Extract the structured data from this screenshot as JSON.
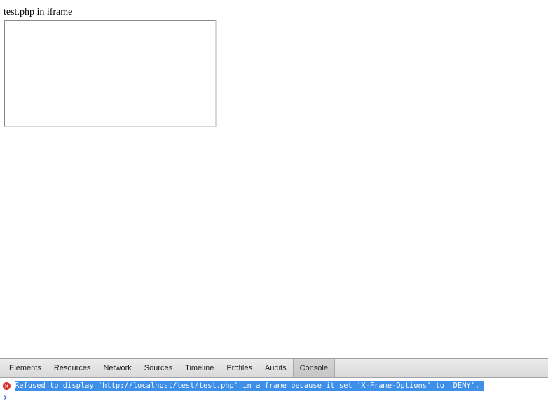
{
  "page": {
    "heading": "test.php in iframe"
  },
  "devtools": {
    "tabs": [
      {
        "label": "Elements",
        "selected": false
      },
      {
        "label": "Resources",
        "selected": false
      },
      {
        "label": "Network",
        "selected": false
      },
      {
        "label": "Sources",
        "selected": false
      },
      {
        "label": "Timeline",
        "selected": false
      },
      {
        "label": "Profiles",
        "selected": false
      },
      {
        "label": "Audits",
        "selected": false
      },
      {
        "label": "Console",
        "selected": true
      }
    ],
    "console": {
      "messages": [
        {
          "level": "error",
          "icon": "error-x-icon",
          "text": "Refused to display 'http://localhost/test/test.php' in a frame because it set 'X-Frame-Options' to 'DENY'."
        }
      ],
      "prompt_icon": "chevron-right-icon",
      "prompt_symbol": "›",
      "error_symbol": "×"
    },
    "colors": {
      "selection": "#3d8fe8",
      "error_icon": "#d9302c",
      "prompt": "#2a62c9"
    }
  }
}
